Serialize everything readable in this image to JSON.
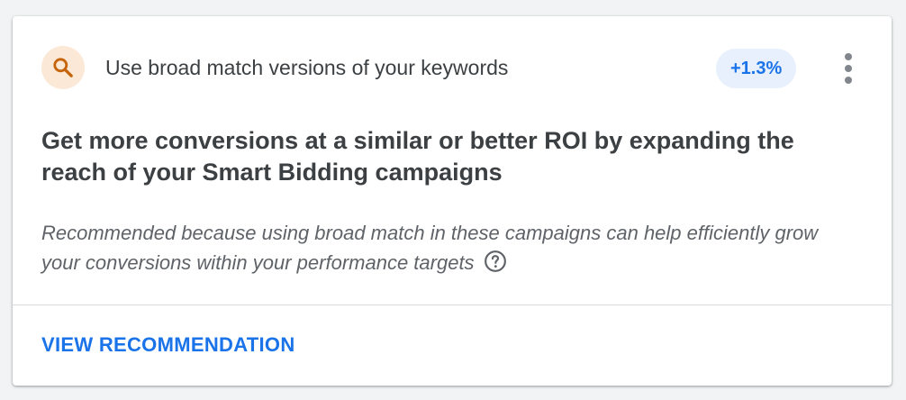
{
  "recommendation": {
    "icon": "search-icon",
    "title": "Use broad match versions of your keywords",
    "score_badge": "+1.3%",
    "menu_icon": "more-vert-icon",
    "headline": "Get more conversions at a similar or better ROI by expanding the reach of your Smart Bidding campaigns",
    "reason": "Recommended because using broad match in these campaigns can help efficiently grow your conversions within your performance targets",
    "help_icon": "help-circle-icon",
    "action_label": "VIEW RECOMMENDATION"
  },
  "colors": {
    "icon_background": "#fce8d6",
    "icon_color": "#c5640a",
    "badge_background": "#e8f0fe",
    "accent": "#1a73e8"
  }
}
